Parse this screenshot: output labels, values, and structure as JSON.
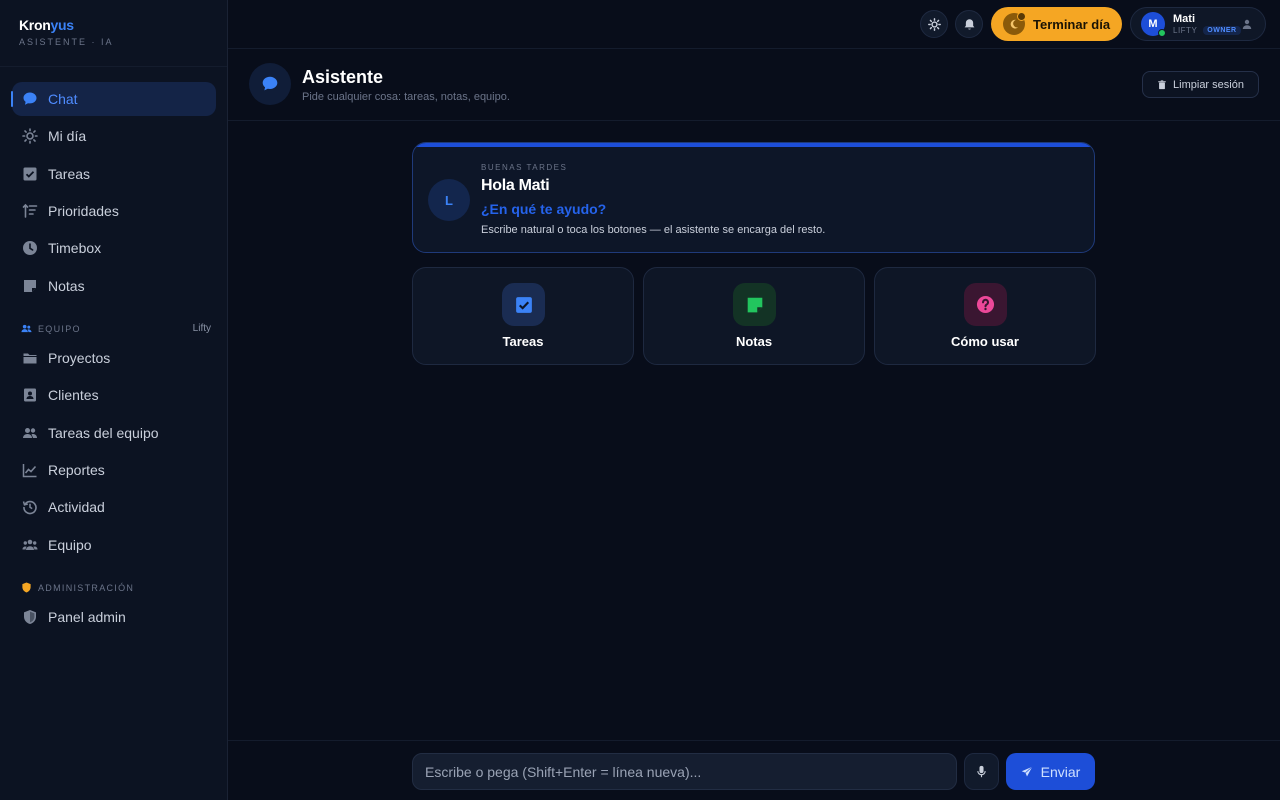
{
  "brand": {
    "name_main": "Kron",
    "name_accent": "yus",
    "subtitle": "ASISTENTE · IA"
  },
  "sidebar": {
    "items": [
      {
        "label": "Chat",
        "icon": "chat-icon"
      },
      {
        "label": "Mi día",
        "icon": "sun-icon"
      },
      {
        "label": "Tareas",
        "icon": "checkbox-icon"
      },
      {
        "label": "Prioridades",
        "icon": "priority-sort-icon"
      },
      {
        "label": "Timebox",
        "icon": "clock-icon"
      },
      {
        "label": "Notas",
        "icon": "note-icon"
      }
    ],
    "team_section": {
      "label": "EQUIPO",
      "workspace": "Lifty"
    },
    "team_items": [
      {
        "label": "Proyectos",
        "icon": "folder-icon"
      },
      {
        "label": "Clientes",
        "icon": "contacts-icon"
      },
      {
        "label": "Tareas del equipo",
        "icon": "team-icon"
      },
      {
        "label": "Reportes",
        "icon": "chart-icon"
      },
      {
        "label": "Actividad",
        "icon": "history-icon"
      },
      {
        "label": "Equipo",
        "icon": "group-icon"
      }
    ],
    "admin_section": {
      "label": "ADMINISTRACIÓN"
    },
    "admin_items": [
      {
        "label": "Panel admin",
        "icon": "shield-icon"
      }
    ]
  },
  "topbar": {
    "end_day_label": "Terminar día",
    "user": {
      "initial": "M",
      "name": "Mati",
      "org": "LIFTY",
      "role": "OWNER"
    }
  },
  "header": {
    "title": "Asistente",
    "subtitle": "Pide cualquier cosa: tareas, notas, equipo.",
    "clear_label": "Limpiar sesión"
  },
  "welcome": {
    "avatar": "L",
    "kicker": "BUENAS TARDES",
    "greeting": "Hola Mati",
    "question": "¿En qué te ayudo?",
    "description": "Escribe natural o toca los botones — el asistente se encarga del resto."
  },
  "actions": [
    {
      "label": "Tareas",
      "icon": "checkbox-icon",
      "color": "#3b82f6"
    },
    {
      "label": "Notas",
      "icon": "note-icon",
      "color": "#22c55e"
    },
    {
      "label": "Cómo usar",
      "icon": "help-icon",
      "color": "#ec4899"
    }
  ],
  "composer": {
    "placeholder": "Escribe o pega (Shift+Enter = línea nueva)...",
    "send_label": "Enviar"
  }
}
